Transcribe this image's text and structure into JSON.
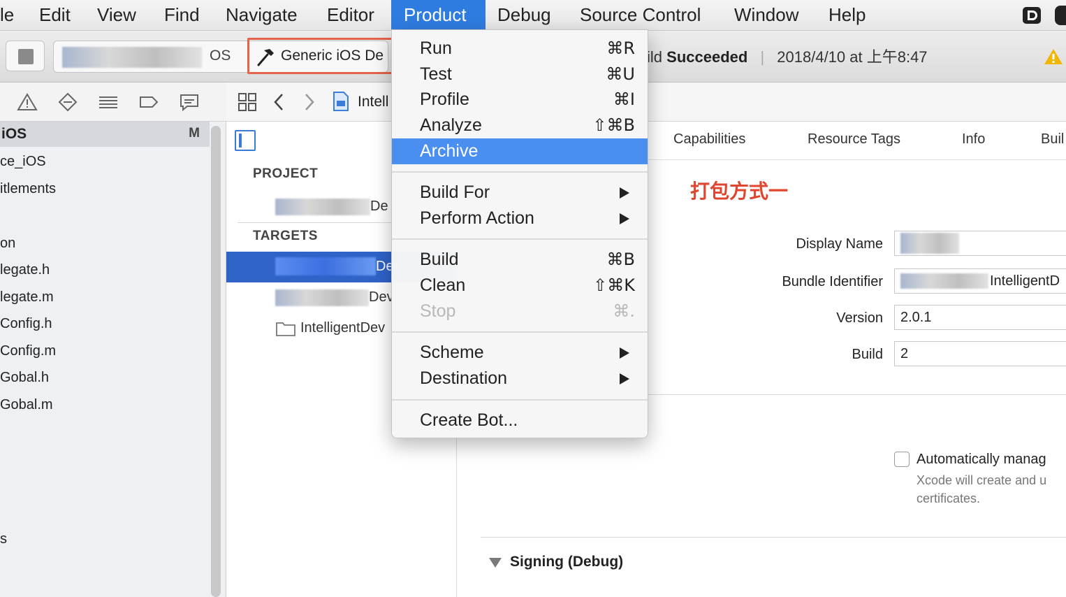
{
  "menubar": {
    "items": [
      "le",
      "Edit",
      "View",
      "Find",
      "Navigate",
      "Editor",
      "Product",
      "Debug",
      "Source Control",
      "Window",
      "Help"
    ],
    "active": "Product"
  },
  "toolbar": {
    "scheme_suffix": "OS",
    "destination": "Generic iOS De",
    "status_prefix": "ild",
    "status_word": "Succeeded",
    "timestamp": "2018/4/10 at 上午8:47"
  },
  "navigator": {
    "header_title": "iOS",
    "header_badge": "M",
    "files": [
      "ce_iOS",
      "itlements",
      "on",
      "legate.h",
      "legate.m",
      "Config.h",
      "Config.m",
      "Gobal.h",
      "Gobal.m",
      "s"
    ]
  },
  "jumpbar": {
    "label": "Intell"
  },
  "targets_panel": {
    "project_label": "PROJECT",
    "project_item_suffix": "De",
    "targets_label": "TARGETS",
    "targets": [
      {
        "suffix": "De",
        "selected": true
      },
      {
        "suffix": "Dev",
        "selected": false
      },
      {
        "label": "IntelligentDev",
        "selected": false
      }
    ]
  },
  "editor": {
    "tabs": [
      "Capabilities",
      "Resource Tags",
      "Info",
      "Buil"
    ],
    "annotation": "打包方式一",
    "identity": {
      "display_name_label": "Display Name",
      "bundle_id_label": "Bundle Identifier",
      "bundle_id_suffix": "IntelligentD",
      "version_label": "Version",
      "version_value": "2.0.1",
      "build_label": "Build",
      "build_value": "2"
    },
    "signing": {
      "auto_manage_label": "Automatically manag",
      "auto_manage_desc": "Xcode will create and u certificates.",
      "section_title": "Signing (Debug)"
    }
  },
  "dropdown": {
    "items": [
      {
        "label": "Run",
        "shortcut": "⌘R"
      },
      {
        "label": "Test",
        "shortcut": "⌘U"
      },
      {
        "label": "Profile",
        "shortcut": "⌘I"
      },
      {
        "label": "Analyze",
        "shortcut": "⇧⌘B"
      },
      {
        "label": "Archive",
        "shortcut": "",
        "highlighted": true
      },
      {
        "label": "Build For",
        "submenu": true
      },
      {
        "label": "Perform Action",
        "submenu": true
      },
      {
        "label": "Build",
        "shortcut": "⌘B"
      },
      {
        "label": "Clean",
        "shortcut": "⇧⌘K"
      },
      {
        "label": "Stop",
        "shortcut": "⌘.",
        "disabled": true
      },
      {
        "label": "Scheme",
        "submenu": true
      },
      {
        "label": "Destination",
        "submenu": true
      },
      {
        "label": "Create Bot...",
        "shortcut": ""
      }
    ]
  },
  "colors": {
    "menu_active": "#2f7ce0",
    "menu_highlight": "#4a8ff0",
    "selection": "#2f63c8",
    "annotation": "#e0452f",
    "destination_outline": "#e4634c",
    "warning": "#f2b705"
  }
}
